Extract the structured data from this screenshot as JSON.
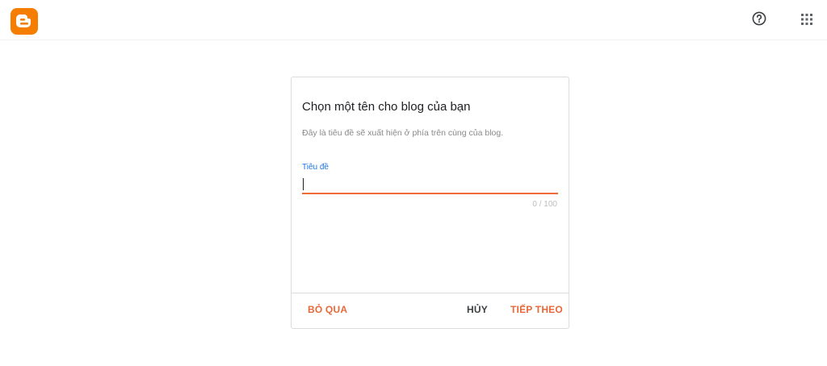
{
  "header": {
    "logo_icon": "blogger-logo-icon",
    "help_icon": "help-circle-icon",
    "apps_icon": "apps-grid-icon"
  },
  "dialog": {
    "title": "Chọn một tên cho blog của bạn",
    "description": "Đây là tiêu đề sẽ xuất hiện ở phía trên cùng của blog.",
    "field_label": "Tiêu đề",
    "field_value": "",
    "counter": "0 / 100",
    "buttons": {
      "skip": "BỎ QUA",
      "cancel": "HỦY",
      "next": "TIẾP THEO"
    }
  },
  "colors": {
    "brand": "#f06a35",
    "label_blue": "#1a73e8"
  }
}
